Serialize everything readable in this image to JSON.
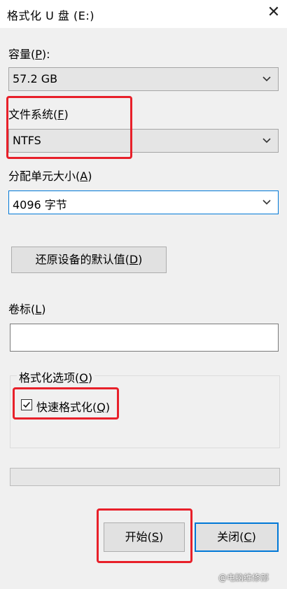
{
  "window": {
    "title": "格式化 U 盘 (E:)",
    "close_glyph": "✕"
  },
  "capacity": {
    "label": "容量",
    "hotkey": "P",
    "value": "57.2 GB"
  },
  "filesystem": {
    "label": "文件系统",
    "hotkey": "F",
    "value": "NTFS"
  },
  "allocation": {
    "label": "分配单元大小",
    "hotkey": "A",
    "value": "4096 字节"
  },
  "restore_button": {
    "label": "还原设备的默认值",
    "hotkey": "D"
  },
  "volume_label": {
    "label": "卷标",
    "hotkey": "L",
    "value": ""
  },
  "format_options": {
    "title": "格式化选项",
    "title_hotkey": "O",
    "quick_format": {
      "label": "快速格式化",
      "hotkey": "Q",
      "checked": true
    }
  },
  "progress": {
    "value": 0
  },
  "buttons": {
    "start": {
      "label": "开始",
      "hotkey": "S"
    },
    "close": {
      "label": "关闭",
      "hotkey": "C"
    }
  },
  "watermark": "@电脑维修部"
}
